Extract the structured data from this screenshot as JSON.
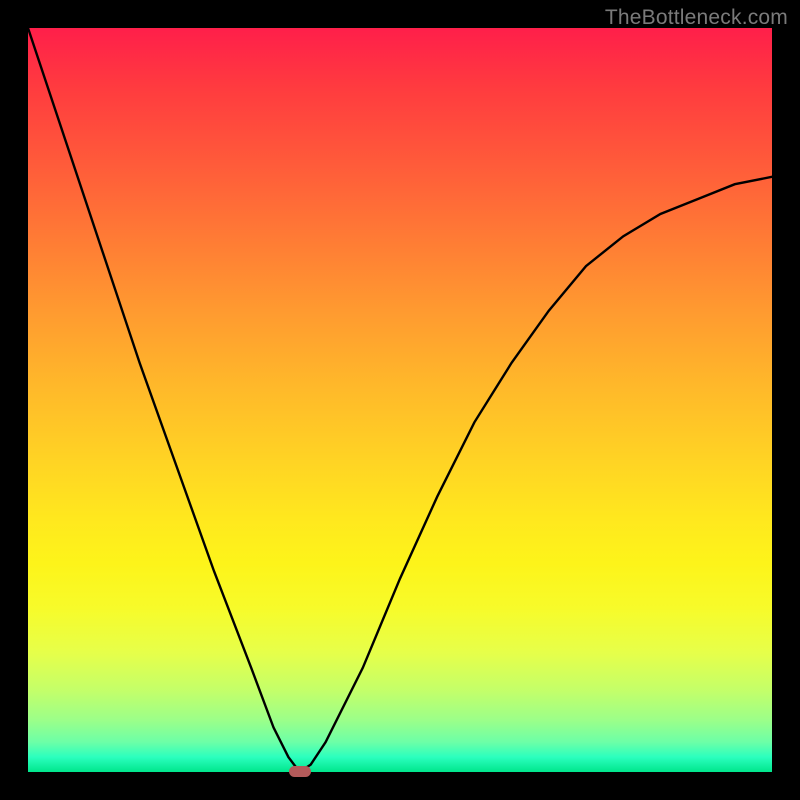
{
  "watermark": "TheBottleneck.com",
  "colors": {
    "frame_bg": "#000000",
    "gradient_top": "#ff1f4a",
    "gradient_bottom": "#00e68c",
    "curve": "#000000",
    "tick": "#b35a5a"
  },
  "chart_data": {
    "type": "line",
    "title": "",
    "xlabel": "",
    "ylabel": "",
    "xlim": [
      0,
      100
    ],
    "ylim": [
      0,
      100
    ],
    "series": [
      {
        "name": "bottleneck-curve",
        "x": [
          0,
          5,
          10,
          15,
          20,
          25,
          30,
          33,
          35,
          36.5,
          38,
          40,
          45,
          50,
          55,
          60,
          65,
          70,
          75,
          80,
          85,
          90,
          95,
          100
        ],
        "y": [
          100,
          85,
          70,
          55,
          41,
          27,
          14,
          6,
          2,
          0,
          1,
          4,
          14,
          26,
          37,
          47,
          55,
          62,
          68,
          72,
          75,
          77,
          79,
          80
        ]
      }
    ],
    "marker": {
      "x": 36.5,
      "y": 0
    }
  }
}
